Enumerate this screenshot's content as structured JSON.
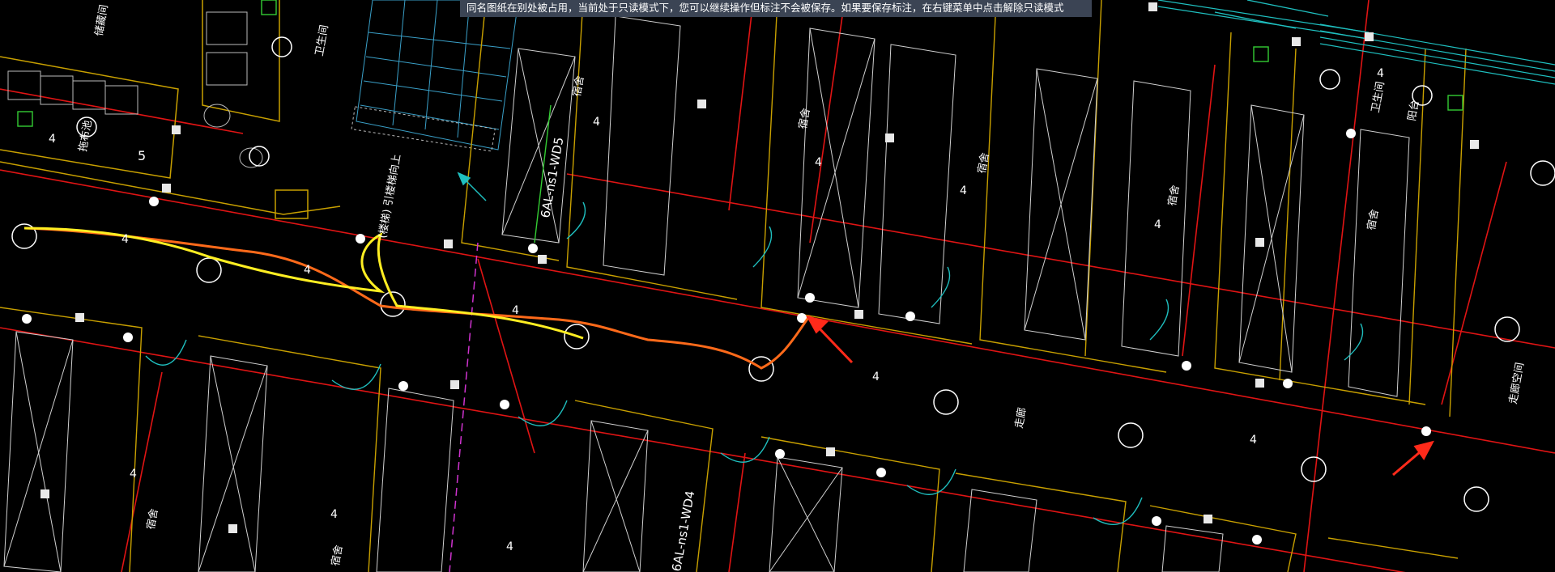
{
  "banner": {
    "message": "同名图纸在别处被占用，当前处于只读模式下，您可以继续操作但标注不会被保存。如果要保存标注，在右键菜单中点击解除只读模式"
  },
  "drawing": {
    "circuit_labels": [
      "6AL-ns1-WD5",
      "6AL-ns1-WD4"
    ],
    "room_labels": {
      "dorm": "宿舍",
      "bathroom": "卫生间",
      "corridor": "走廊",
      "stair_note": "(楼梯) 引楼梯向上",
      "storage": "储藏间",
      "mop_room": "拖布池",
      "right_room": "阳台",
      "yard_label": "走廊空间"
    },
    "wire_count_labels": [
      "4",
      "4",
      "4",
      "4",
      "4",
      "5",
      "4",
      "4",
      "4",
      "4",
      "4",
      "4",
      "4",
      "4",
      "4"
    ],
    "colors": {
      "background": "#000000",
      "wall": "#c8a000",
      "red_line": "#e01414",
      "cyan_door": "#1fbfbf",
      "yellow_trace": "#ffee22",
      "orange_trace": "#ff6a1a",
      "marker_arrow": "#ff2a1a",
      "green_mark": "#33cc33",
      "light_fixture": "#ffffff"
    }
  }
}
